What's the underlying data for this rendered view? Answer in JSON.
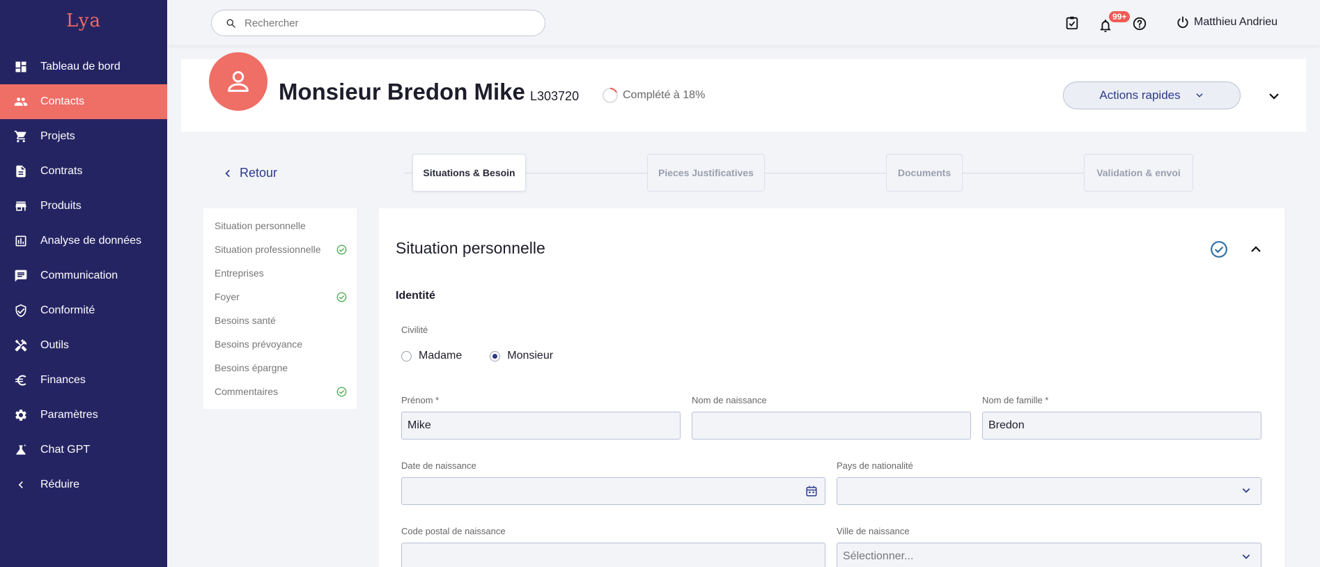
{
  "app": {
    "logo": "Lya"
  },
  "sidebar": {
    "items": [
      {
        "label": "Tableau de bord",
        "icon": "dashboard-icon"
      },
      {
        "label": "Contacts",
        "icon": "people-icon"
      },
      {
        "label": "Projets",
        "icon": "cart-icon"
      },
      {
        "label": "Contrats",
        "icon": "document-icon"
      },
      {
        "label": "Produits",
        "icon": "store-icon"
      },
      {
        "label": "Analyse de données",
        "icon": "chart-icon"
      },
      {
        "label": "Communication",
        "icon": "message-icon"
      },
      {
        "label": "Conformité",
        "icon": "shield-icon"
      },
      {
        "label": "Outils",
        "icon": "tools-icon"
      },
      {
        "label": "Finances",
        "icon": "euro-icon"
      },
      {
        "label": "Paramètres",
        "icon": "gear-icon"
      },
      {
        "label": "Chat GPT",
        "icon": "lab-icon"
      },
      {
        "label": "Réduire",
        "icon": "chevron-left-icon"
      }
    ],
    "active_index": 1
  },
  "topbar": {
    "search_placeholder": "Rechercher",
    "notification_badge": "99+",
    "user_name": "Matthieu Andrieu"
  },
  "profile": {
    "name": "Monsieur Bredon Mike",
    "id": "L303720",
    "completion_text": "Complété à 18%",
    "completion": 0.18,
    "actions_label": "Actions rapides"
  },
  "nav": {
    "back_label": "Retour"
  },
  "steps": [
    {
      "label": "Situations & Besoin",
      "active": true
    },
    {
      "label": "Pieces Justificatives",
      "active": false
    },
    {
      "label": "Documents",
      "active": false
    },
    {
      "label": "Validation & envoi",
      "active": false
    }
  ],
  "sections": [
    {
      "label": "Situation personnelle",
      "done": false
    },
    {
      "label": "Situation professionnelle",
      "done": true
    },
    {
      "label": "Entreprises",
      "done": false
    },
    {
      "label": "Foyer",
      "done": true
    },
    {
      "label": "Besoins santé",
      "done": false
    },
    {
      "label": "Besoins prévoyance",
      "done": false
    },
    {
      "label": "Besoins épargne",
      "done": false
    },
    {
      "label": "Commentaires",
      "done": true
    }
  ],
  "form": {
    "title": "Situation personnelle",
    "subhead": "Identité",
    "civility_label": "Civilité",
    "civility_options": [
      "Madame",
      "Monsieur"
    ],
    "civility_selected": "Monsieur",
    "first_name_label": "Prénom *",
    "first_name_value": "Mike",
    "birth_name_label": "Nom de naissance",
    "birth_name_value": "",
    "last_name_label": "Nom de famille *",
    "last_name_value": "Bredon",
    "birth_date_label": "Date de naissance",
    "birth_date_value": "",
    "nationality_label": "Pays de nationalité",
    "nationality_value": "",
    "birth_postal_label": "Code postal de naissance",
    "birth_postal_value": "",
    "birth_city_label": "Ville de naissance",
    "birth_city_placeholder": "Sélectionner..."
  },
  "colors": {
    "sidebar_bg": "#252463",
    "accent": "#ef6e66",
    "primary_text": "#2c3a8c",
    "success": "#3fa64a"
  }
}
